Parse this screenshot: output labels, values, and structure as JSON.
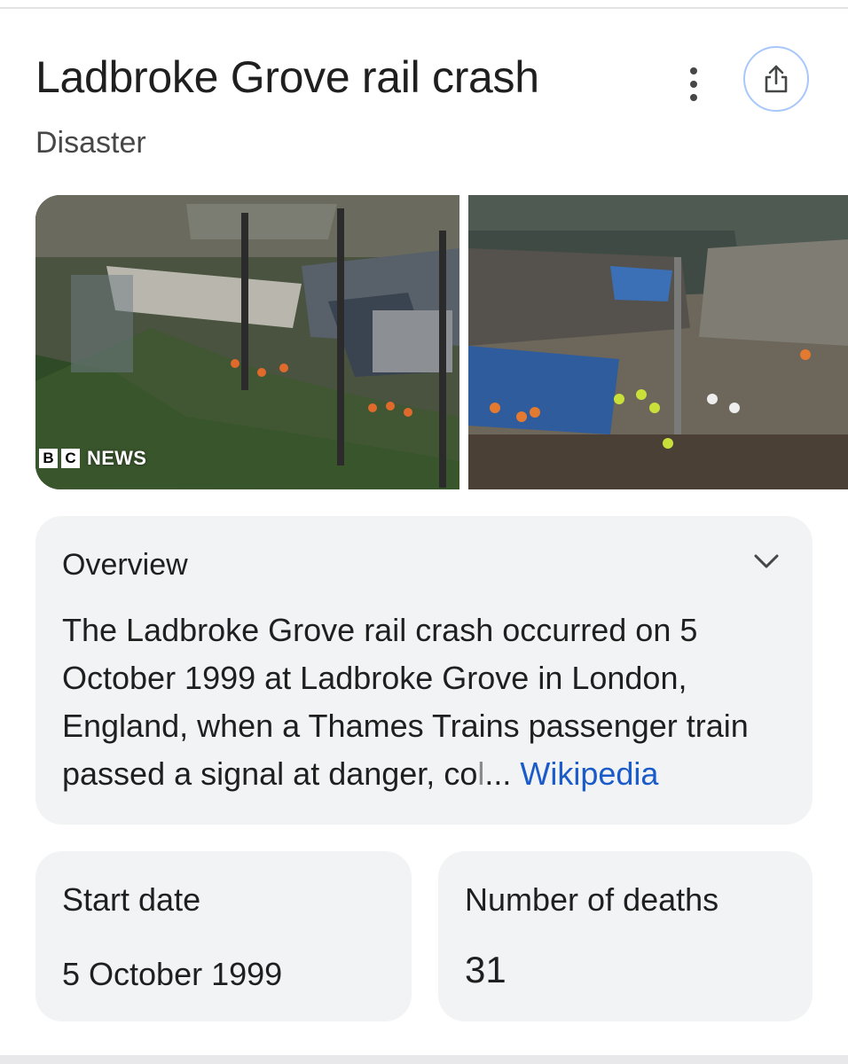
{
  "header": {
    "title": "Ladbroke Grove rail crash",
    "subtitle": "Disaster",
    "more_icon": "more-vert-icon",
    "share_icon": "share-icon"
  },
  "images": {
    "left": {
      "watermark_box_1": "B",
      "watermark_box_2": "C",
      "watermark_text": "NEWS"
    },
    "right": {}
  },
  "overview": {
    "heading": "Overview",
    "text": "The Ladbroke Grove rail crash occurred on 5 October 1999 at Ladbroke Grove in London, England, when a Thames Trains passenger train passed a signal at danger, co",
    "text_faded": "l",
    "ellipsis": "... ",
    "link": "Wikipedia",
    "expand_icon": "chevron-down-icon"
  },
  "facts": [
    {
      "label": "Start date",
      "value": "5 October 1999"
    },
    {
      "label": "Number of deaths",
      "value": "31"
    }
  ],
  "colors": {
    "link": "#1a5bc9",
    "card_bg": "#f1f3f4",
    "share_ring": "#a8c7fa"
  }
}
